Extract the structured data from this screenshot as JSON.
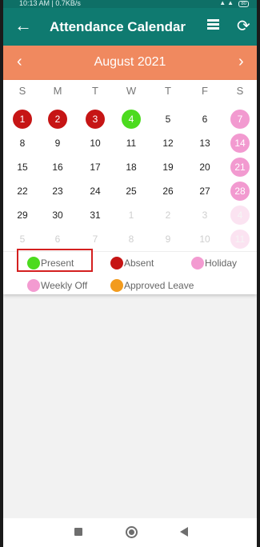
{
  "status_bar": {
    "left": "10:13 AM | 0.7KB/s",
    "right": "…",
    "battery": "80"
  },
  "app_bar": {
    "title": "Attendance Calendar",
    "back_icon": "arrow-back-icon",
    "list_icon": "list-icon",
    "refresh_icon": "refresh-icon"
  },
  "calendar": {
    "month_title": "August  2021",
    "weekdays": [
      "S",
      "M",
      "T",
      "W",
      "T",
      "F",
      "S"
    ],
    "weeks": [
      [
        {
          "d": "1",
          "s": "absent"
        },
        {
          "d": "2",
          "s": "absent"
        },
        {
          "d": "3",
          "s": "absent"
        },
        {
          "d": "4",
          "s": "present"
        },
        {
          "d": "5",
          "s": ""
        },
        {
          "d": "6",
          "s": ""
        },
        {
          "d": "7",
          "s": "weekoff"
        }
      ],
      [
        {
          "d": "8",
          "s": ""
        },
        {
          "d": "9",
          "s": ""
        },
        {
          "d": "10",
          "s": ""
        },
        {
          "d": "11",
          "s": ""
        },
        {
          "d": "12",
          "s": ""
        },
        {
          "d": "13",
          "s": ""
        },
        {
          "d": "14",
          "s": "weekoff"
        }
      ],
      [
        {
          "d": "15",
          "s": ""
        },
        {
          "d": "16",
          "s": ""
        },
        {
          "d": "17",
          "s": ""
        },
        {
          "d": "18",
          "s": ""
        },
        {
          "d": "19",
          "s": ""
        },
        {
          "d": "20",
          "s": ""
        },
        {
          "d": "21",
          "s": "weekoff"
        }
      ],
      [
        {
          "d": "22",
          "s": ""
        },
        {
          "d": "23",
          "s": ""
        },
        {
          "d": "24",
          "s": ""
        },
        {
          "d": "25",
          "s": ""
        },
        {
          "d": "26",
          "s": ""
        },
        {
          "d": "27",
          "s": ""
        },
        {
          "d": "28",
          "s": "weekoff"
        }
      ],
      [
        {
          "d": "29",
          "s": ""
        },
        {
          "d": "30",
          "s": ""
        },
        {
          "d": "31",
          "s": ""
        },
        {
          "d": "1",
          "s": "muted"
        },
        {
          "d": "2",
          "s": "muted"
        },
        {
          "d": "3",
          "s": "muted"
        },
        {
          "d": "4",
          "s": "weekoff muted"
        }
      ],
      [
        {
          "d": "5",
          "s": "muted"
        },
        {
          "d": "6",
          "s": "muted"
        },
        {
          "d": "7",
          "s": "muted"
        },
        {
          "d": "8",
          "s": "muted"
        },
        {
          "d": "9",
          "s": "muted"
        },
        {
          "d": "10",
          "s": "muted"
        },
        {
          "d": "11",
          "s": "weekoff muted"
        }
      ]
    ]
  },
  "legend": [
    {
      "label": "Present",
      "color": "#4cdb1f"
    },
    {
      "label": "Absent",
      "color": "#c61515"
    },
    {
      "label": "Holiday",
      "color": "#f39bd1"
    },
    {
      "label": "Weekly Off",
      "color": "#f39bd1"
    },
    {
      "label": "Approved Leave",
      "color": "#f29b1e"
    }
  ],
  "colors": {
    "app_bar": "#0f7a70",
    "month_bar": "#f0895f",
    "absent": "#c61515",
    "present": "#4cdb1f",
    "weekly_off": "#f29ad0",
    "approved_leave": "#f29b1e"
  }
}
